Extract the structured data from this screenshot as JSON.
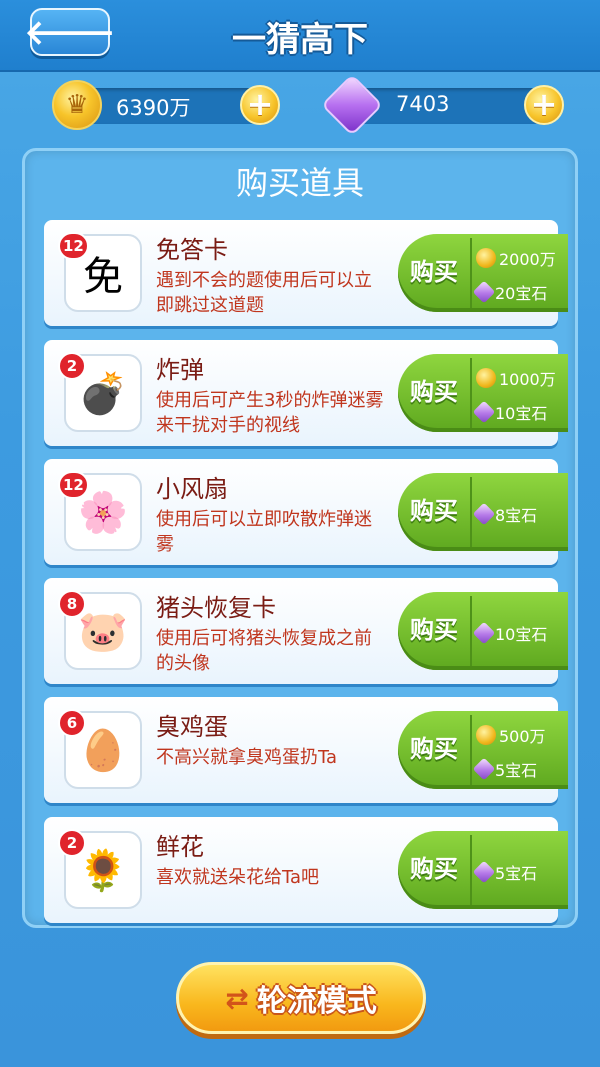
{
  "header": {
    "title": "一猜高下",
    "back_icon": "🡐"
  },
  "currency": {
    "gold": "6390万",
    "gems": "7403",
    "plus": "+"
  },
  "panel": {
    "title": "购买道具"
  },
  "buy_label": "购买",
  "items": [
    {
      "count": "12",
      "name": "免答卡",
      "desc": "遇到不会的题使用后可以立即跳过这道题",
      "thumb": "免",
      "prices": [
        {
          "type": "coin",
          "text": "2000万"
        },
        {
          "type": "gem",
          "text": "20宝石"
        }
      ]
    },
    {
      "count": "2",
      "name": "炸弹",
      "desc": "使用后可产生3秒的炸弹迷雾来干扰对手的视线",
      "thumb": "💣",
      "prices": [
        {
          "type": "coin",
          "text": "1000万"
        },
        {
          "type": "gem",
          "text": "10宝石"
        }
      ]
    },
    {
      "count": "12",
      "name": "小风扇",
      "desc": "使用后可以立即吹散炸弹迷雾",
      "thumb": "🌸",
      "prices": [
        {
          "type": "gem",
          "text": "8宝石"
        }
      ]
    },
    {
      "count": "8",
      "name": "猪头恢复卡",
      "desc": "使用后可将猪头恢复成之前的头像",
      "thumb": "🐷",
      "prices": [
        {
          "type": "gem",
          "text": "10宝石"
        }
      ]
    },
    {
      "count": "6",
      "name": "臭鸡蛋",
      "desc": "不高兴就拿臭鸡蛋扔Ta",
      "thumb": "🥚",
      "prices": [
        {
          "type": "coin",
          "text": "500万"
        },
        {
          "type": "gem",
          "text": "5宝石"
        }
      ]
    },
    {
      "count": "2",
      "name": "鲜花",
      "desc": "喜欢就送朵花给Ta吧",
      "thumb": "🌻",
      "prices": [
        {
          "type": "gem",
          "text": "5宝石"
        }
      ]
    }
  ],
  "bottom": {
    "mode_label": "轮流模式",
    "mode_icon": "⇄"
  }
}
